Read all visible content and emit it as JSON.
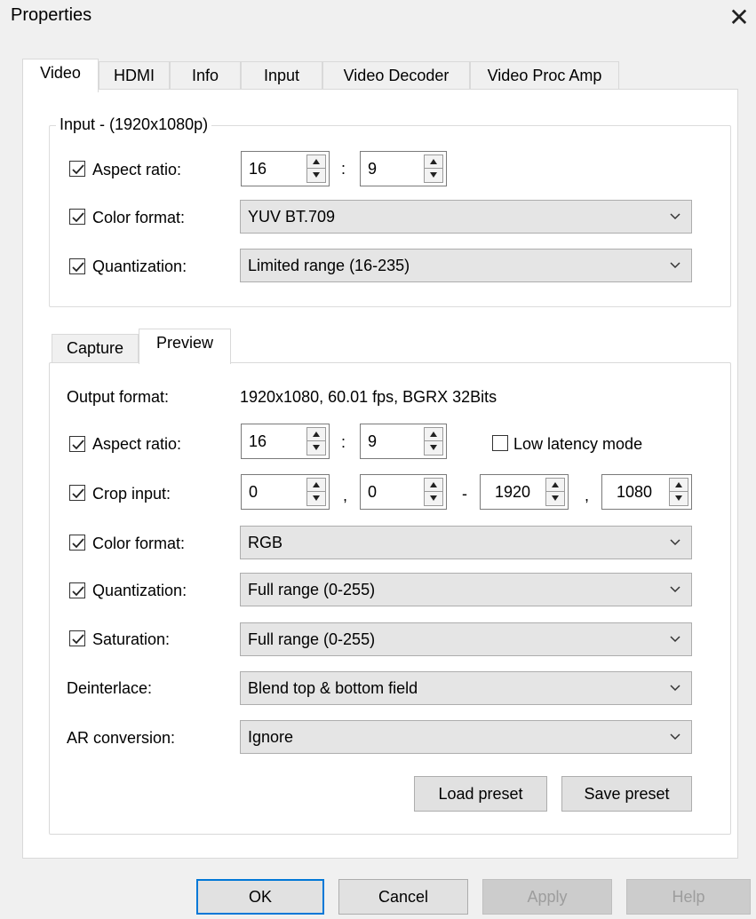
{
  "window": {
    "title": "Properties",
    "close_glyph": "✕"
  },
  "top_tabs": [
    "Video",
    "HDMI",
    "Info",
    "Input",
    "Video Decoder",
    "Video Proc Amp"
  ],
  "input_group": {
    "label": "Input - (1920x1080p)",
    "aspect_label": "Aspect ratio:",
    "aspect_w": "16",
    "aspect_sep": ":",
    "aspect_h": "9",
    "color_label": "Color format:",
    "color_value": "YUV BT.709",
    "quant_label": "Quantization:",
    "quant_value": "Limited range (16-235)"
  },
  "sub_tabs": [
    "Capture",
    "Preview"
  ],
  "preview": {
    "output_label": "Output format:",
    "output_value": "1920x1080, 60.01 fps, BGRX 32Bits",
    "aspect_label": "Aspect ratio:",
    "aspect_w": "16",
    "aspect_sep": ":",
    "aspect_h": "9",
    "low_latency_label": "Low latency mode",
    "crop_label": "Crop input:",
    "crop_x": "0",
    "crop_y": "0",
    "crop_w": "1920",
    "crop_h": "1080",
    "crop_sep1": ",",
    "crop_sep2": "-",
    "crop_sep3": ",",
    "color_label": "Color format:",
    "color_value": "RGB",
    "quant_label": "Quantization:",
    "quant_value": "Full range (0-255)",
    "sat_label": "Saturation:",
    "sat_value": "Full range (0-255)",
    "deint_label": "Deinterlace:",
    "deint_value": "Blend top & bottom field",
    "ar_label": "AR conversion:",
    "ar_value": "Ignore",
    "load_preset": "Load preset",
    "save_preset": "Save preset"
  },
  "footer": {
    "ok": "OK",
    "cancel": "Cancel",
    "apply": "Apply",
    "help": "Help"
  },
  "colors": {
    "accent": "#0078d7",
    "dialog_bg": "#f0f0f0",
    "panel_bg": "#ffffff"
  },
  "icons": [
    "close-icon",
    "checkmark-icon",
    "spin-up-icon",
    "spin-down-icon",
    "chevron-down-icon"
  ]
}
